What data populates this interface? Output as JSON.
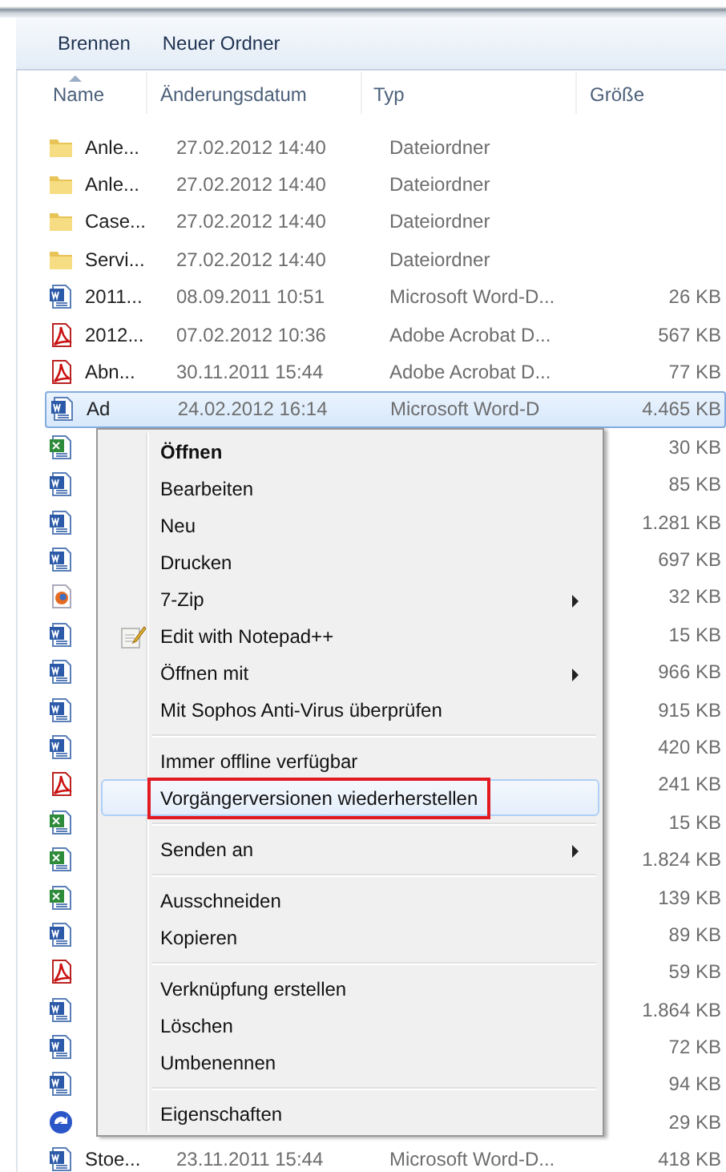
{
  "toolbar": {
    "buttons": [
      "Brennen",
      "Neuer Ordner"
    ]
  },
  "columns": [
    {
      "label": "Name",
      "sorted": true
    },
    {
      "label": "Änderungsdatum",
      "sorted": false
    },
    {
      "label": "Typ",
      "sorted": false
    },
    {
      "label": "Größe",
      "sorted": false
    }
  ],
  "files": [
    {
      "kind": "folder",
      "name": "Anle...",
      "date": "27.02.2012 14:40",
      "type": "Dateiordner",
      "selected": false
    },
    {
      "kind": "folder",
      "name": "Anle...",
      "date": "27.02.2012 14:40",
      "type": "Dateiordner",
      "selected": false
    },
    {
      "kind": "folder",
      "name": "Case...",
      "date": "27.02.2012 14:40",
      "type": "Dateiordner",
      "selected": false
    },
    {
      "kind": "folder",
      "name": "Servi...",
      "date": "27.02.2012 14:40",
      "type": "Dateiordner",
      "selected": false
    },
    {
      "kind": "word",
      "name": "2011...",
      "date": "08.09.2011 10:51",
      "type": "Microsoft Word-D...",
      "size": "26 KB",
      "selected": false
    },
    {
      "kind": "pdf",
      "name": "2012...",
      "date": "07.02.2012 10:36",
      "type": "Adobe Acrobat D...",
      "size": "567 KB",
      "selected": false
    },
    {
      "kind": "pdf",
      "name": "Abn...",
      "date": "30.11.2011 15:44",
      "type": "Adobe Acrobat D...",
      "size": "77 KB",
      "selected": false
    },
    {
      "kind": "word",
      "name": "Ad",
      "date": "24.02.2012 16:14",
      "type": "Microsoft Word-D",
      "size": "4.465 KB",
      "selected": true
    },
    {
      "kind": "excel",
      "size": "30 KB",
      "selected": false
    },
    {
      "kind": "word",
      "size": "85 KB",
      "selected": false
    },
    {
      "kind": "word",
      "size": "1.281 KB",
      "selected": false
    },
    {
      "kind": "word",
      "size": "697 KB",
      "selected": false
    },
    {
      "kind": "browser",
      "size": "32 KB",
      "selected": false
    },
    {
      "kind": "word",
      "size": "15 KB",
      "selected": false
    },
    {
      "kind": "word",
      "size": "966 KB",
      "selected": false
    },
    {
      "kind": "word",
      "size": "915 KB",
      "selected": false
    },
    {
      "kind": "word",
      "size": "420 KB",
      "selected": false
    },
    {
      "kind": "pdf",
      "size": "241 KB",
      "selected": false
    },
    {
      "kind": "excel",
      "size": "15 KB",
      "selected": false
    },
    {
      "kind": "excel",
      "size": "1.824 KB",
      "selected": false
    },
    {
      "kind": "excel",
      "size": "139 KB",
      "selected": false
    },
    {
      "kind": "word",
      "size": "89 KB",
      "selected": false
    },
    {
      "kind": "pdf",
      "size": "59 KB",
      "selected": false
    },
    {
      "kind": "word",
      "size": "1.864 KB",
      "selected": false
    },
    {
      "kind": "word",
      "size": "72 KB",
      "selected": false
    },
    {
      "kind": "word",
      "size": "94 KB",
      "selected": false
    },
    {
      "kind": "sync",
      "size": "29 KB",
      "selected": false
    },
    {
      "kind": "word",
      "name": "Stoe...",
      "date": "23.11.2011 15:44",
      "type": "Microsoft Word-D...",
      "size": "418 KB",
      "selected": false
    }
  ],
  "context_menu": {
    "items": [
      {
        "kind": "item",
        "label": "Öffnen",
        "default": true,
        "submenu": false,
        "selected": false,
        "outlined": false
      },
      {
        "kind": "item",
        "label": "Bearbeiten",
        "default": false,
        "submenu": false,
        "selected": false,
        "outlined": false
      },
      {
        "kind": "item",
        "label": "Neu",
        "default": false,
        "submenu": false,
        "selected": false,
        "outlined": false
      },
      {
        "kind": "item",
        "label": "Drucken",
        "default": false,
        "submenu": false,
        "selected": false,
        "outlined": false
      },
      {
        "kind": "item",
        "label": "7-Zip",
        "default": false,
        "submenu": true,
        "selected": false,
        "outlined": false
      },
      {
        "kind": "notepad",
        "label": "Edit with Notepad++",
        "default": false,
        "submenu": false,
        "selected": false,
        "outlined": false
      },
      {
        "kind": "item",
        "label": "Öffnen mit",
        "default": false,
        "submenu": true,
        "selected": false,
        "outlined": false
      },
      {
        "kind": "item",
        "label": "Mit Sophos Anti-Virus überprüfen",
        "default": false,
        "submenu": false,
        "selected": false,
        "outlined": false
      },
      {
        "kind": "separator"
      },
      {
        "kind": "item",
        "label": "Immer offline verfügbar",
        "default": false,
        "submenu": false,
        "selected": false,
        "outlined": false
      },
      {
        "kind": "item",
        "label": "Vorgängerversionen wiederherstellen",
        "default": false,
        "submenu": false,
        "selected": true,
        "outlined": true
      },
      {
        "kind": "separator"
      },
      {
        "kind": "item",
        "label": "Senden an",
        "default": false,
        "submenu": true,
        "selected": false,
        "outlined": false
      },
      {
        "kind": "separator"
      },
      {
        "kind": "item",
        "label": "Ausschneiden",
        "default": false,
        "submenu": false,
        "selected": false,
        "outlined": false
      },
      {
        "kind": "item",
        "label": "Kopieren",
        "default": false,
        "submenu": false,
        "selected": false,
        "outlined": false
      },
      {
        "kind": "separator"
      },
      {
        "kind": "item",
        "label": "Verknüpfung erstellen",
        "default": false,
        "submenu": false,
        "selected": false,
        "outlined": false
      },
      {
        "kind": "item",
        "label": "Löschen",
        "default": false,
        "submenu": false,
        "selected": false,
        "outlined": false
      },
      {
        "kind": "item",
        "label": "Umbenennen",
        "default": false,
        "submenu": false,
        "selected": false,
        "outlined": false
      },
      {
        "kind": "separator"
      },
      {
        "kind": "item",
        "label": "Eigenschaften",
        "default": false,
        "submenu": false,
        "selected": false,
        "outlined": false
      }
    ]
  }
}
